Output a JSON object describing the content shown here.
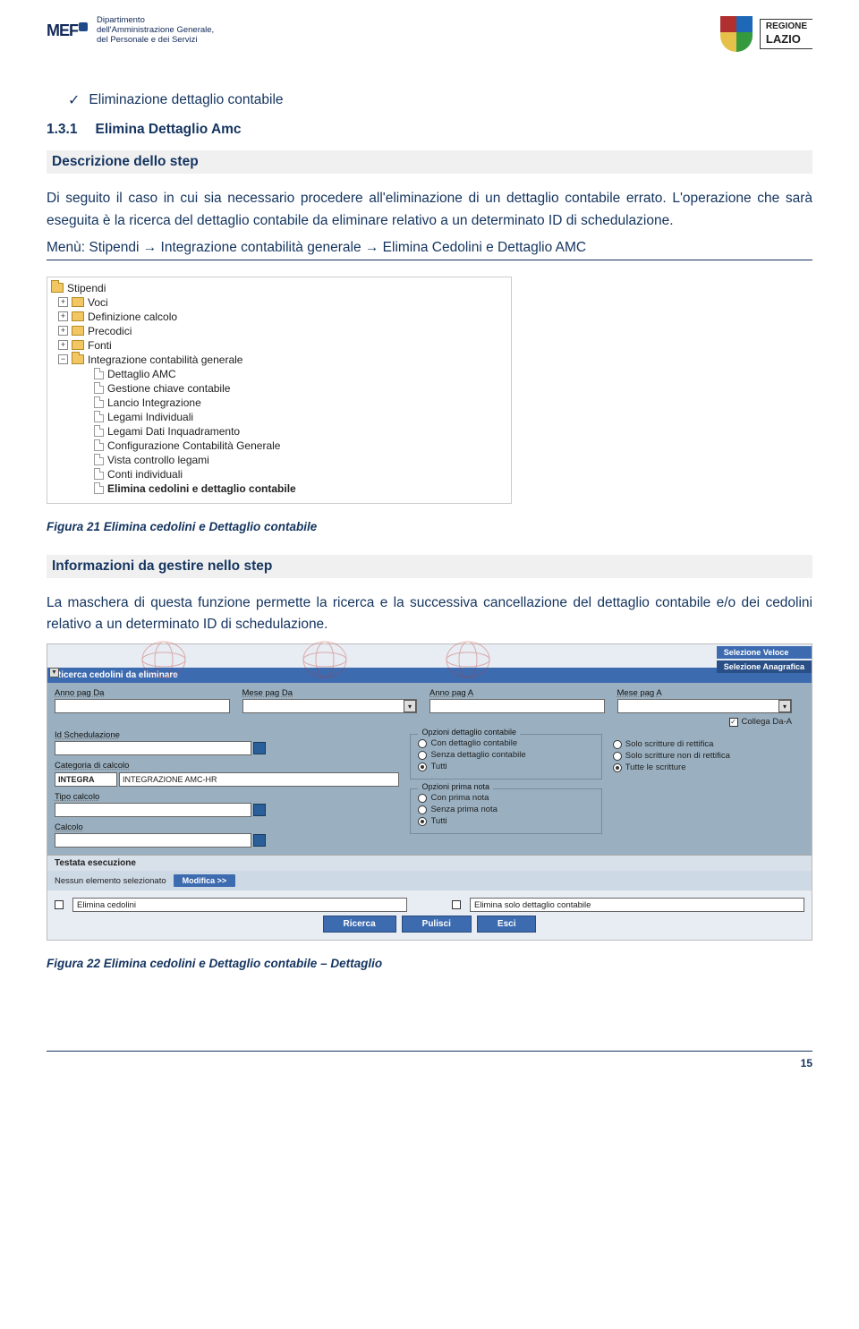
{
  "header": {
    "mef": {
      "logo": "MEF",
      "lines": [
        "Dipartimento",
        "dell'Amministrazione Generale,",
        "del Personale e dei Servizi"
      ]
    },
    "lazio": {
      "top": "REGIONE",
      "bottom": "LAZIO"
    }
  },
  "bullet": "Eliminazione dettaglio contabile",
  "section": {
    "num": "1.3.1",
    "title": "Elimina Dettaglio Amc"
  },
  "headings": {
    "descr": "Descrizione dello step",
    "info": "Informazioni da gestire nello step"
  },
  "paragraphs": {
    "p1": "Di seguito il caso in cui sia necessario procedere all'eliminazione di un dettaglio contabile errato. L'operazione che sarà eseguita è la ricerca del dettaglio contabile da eliminare relativo a un determinato ID di schedulazione.",
    "menu": "Menù: Stipendi → Integrazione contabilità generale → Elimina Cedolini e Dettaglio AMC",
    "p2": "La maschera di questa funzione permette la ricerca e la successiva cancellazione del dettaglio contabile  e/o dei cedolini relativo a un determinato ID di schedulazione."
  },
  "tree": {
    "root": "Stipendi",
    "folders": [
      "Voci",
      "Definizione calcolo",
      "Precodici",
      "Fonti",
      "Integrazione contabilità generale"
    ],
    "items": [
      "Dettaglio AMC",
      "Gestione chiave contabile",
      "Lancio Integrazione",
      "Legami Individuali",
      "Legami Dati Inquadramento",
      "Configurazione Contabilità Generale",
      "Vista controllo legami",
      "Conti individuali",
      "Elimina cedolini e dettaglio contabile"
    ]
  },
  "captions": {
    "fig21": "Figura 21 Elimina cedolini e Dettaglio contabile",
    "fig22": "Figura 22 Elimina cedolini e Dettaglio contabile – Dettaglio"
  },
  "form": {
    "tabs": {
      "veloce": "Selezione Veloce",
      "anag": "Selezione Anagrafica"
    },
    "panel_title": "Ricerca cedolini da eliminare",
    "labels": {
      "anno_da": "Anno pag Da",
      "mese_da": "Mese pag Da",
      "anno_a": "Anno pag A",
      "mese_a": "Mese pag A",
      "collega": "Collega Da-A",
      "idsched": "Id Schedulazione",
      "categoria": "Categoria di calcolo",
      "tipo": "Tipo calcolo",
      "calcolo": "Calcolo"
    },
    "categoria": {
      "code": "INTEGRA",
      "desc": "INTEGRAZIONE AMC-HR"
    },
    "opz_dett": {
      "legend": "Opzioni dettaglio contabile",
      "o1": "Con dettaglio contabile",
      "o2": "Senza dettaglio contabile",
      "o3": "Tutti"
    },
    "opz_scr": {
      "o1": "Solo scritture di rettifica",
      "o2": "Solo scritture non di rettifica",
      "o3": "Tutte le scritture"
    },
    "opz_prima": {
      "legend": "Opzioni prima nota",
      "o1": "Con prima nota",
      "o2": "Senza prima nota",
      "o3": "Tutti"
    },
    "testata": {
      "title": "Testata esecuzione",
      "none": "Nessun elemento selezionato",
      "modifica": "Modifica >>"
    },
    "actions": {
      "chk1": "Elimina cedolini",
      "chk2": "Elimina solo dettaglio contabile"
    },
    "buttons": {
      "ricerca": "Ricerca",
      "pulisci": "Pulisci",
      "esci": "Esci"
    }
  },
  "page_number": "15"
}
